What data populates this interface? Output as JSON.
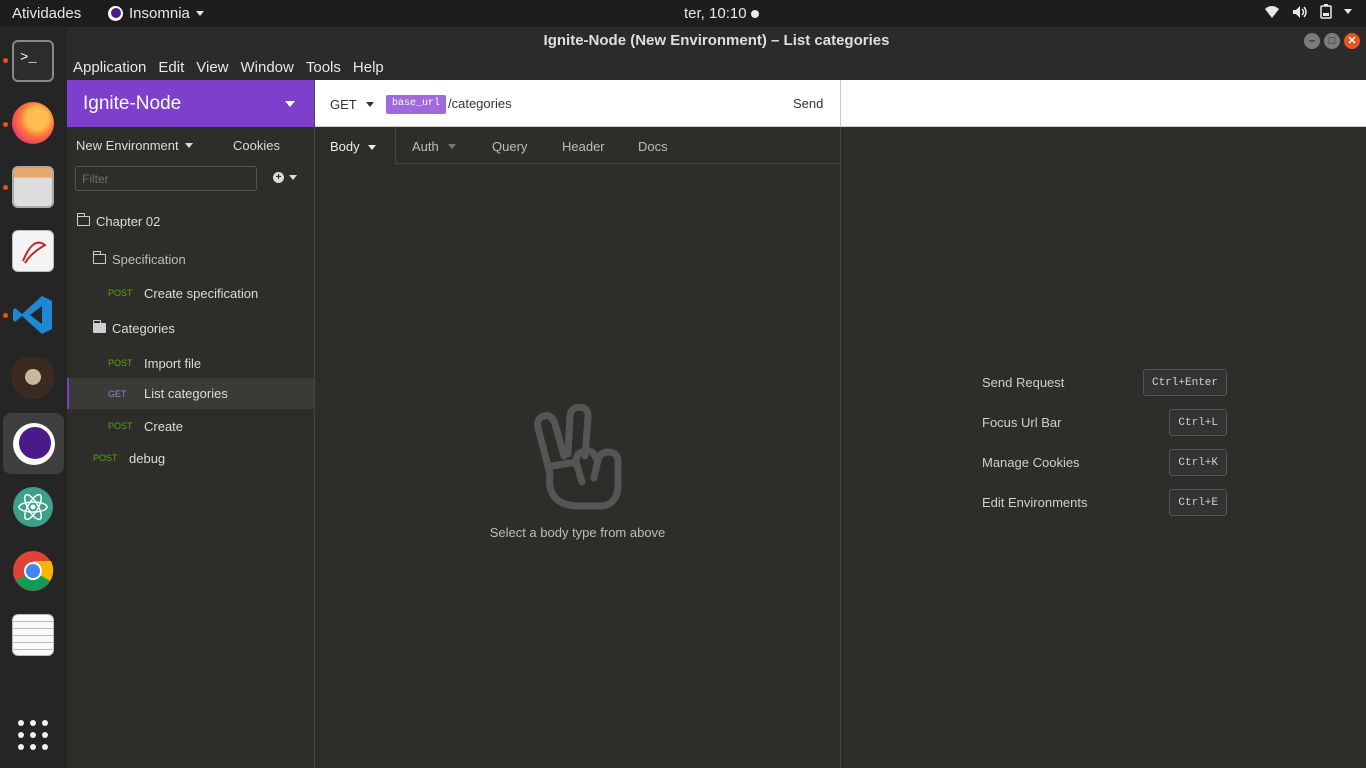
{
  "topbar": {
    "activities": "Atividades",
    "app_name": "Insomnia",
    "clock": "ter, 10:10"
  },
  "window": {
    "title": "Ignite-Node (New Environment) – List categories"
  },
  "menu": [
    "Application",
    "Edit",
    "View",
    "Window",
    "Tools",
    "Help"
  ],
  "sidebar": {
    "workspace": "Ignite-Node",
    "environment": "New Environment",
    "cookies": "Cookies",
    "filter_placeholder": "Filter",
    "tree": [
      {
        "type": "folder",
        "label": "Chapter 02"
      },
      {
        "type": "folder",
        "label": "Specification"
      },
      {
        "type": "request",
        "method": "POST",
        "label": "Create specification"
      },
      {
        "type": "folder",
        "label": "Categories"
      },
      {
        "type": "request",
        "method": "POST",
        "label": "Import file"
      },
      {
        "type": "request",
        "method": "GET",
        "label": "List categories",
        "selected": true
      },
      {
        "type": "request",
        "method": "POST",
        "label": "Create"
      },
      {
        "type": "request",
        "method": "POST",
        "label": "debug"
      }
    ]
  },
  "request": {
    "method": "GET",
    "url_tag": "base_url",
    "url_path": "/categories",
    "send": "Send",
    "tabs": [
      "Body",
      "Auth",
      "Query",
      "Header",
      "Docs"
    ],
    "body_hint": "Select a body type from above"
  },
  "shortcuts": [
    {
      "label": "Send Request",
      "key": "Ctrl+Enter"
    },
    {
      "label": "Focus Url Bar",
      "key": "Ctrl+L"
    },
    {
      "label": "Manage Cookies",
      "key": "Ctrl+K"
    },
    {
      "label": "Edit Environments",
      "key": "Ctrl+E"
    }
  ],
  "colors": {
    "accent": "#7d3fcc",
    "post": "#59a210",
    "get": "#a37fd9",
    "ubuntu_orange": "#e95420"
  }
}
